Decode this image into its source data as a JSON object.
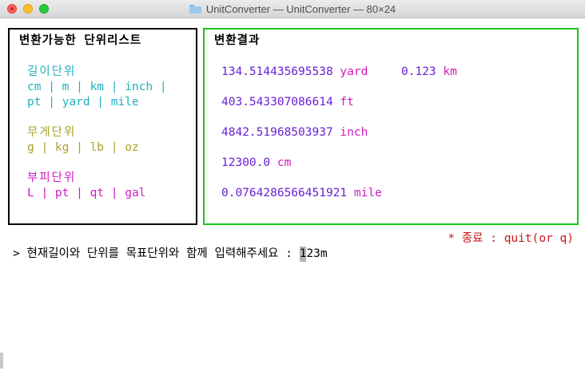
{
  "window": {
    "title": "UnitConverter — UnitConverter — 80×24"
  },
  "left_panel": {
    "heading": "변환가능한 단위리스트",
    "length": {
      "title": "길이단위",
      "line1": "cm | m | km | inch |",
      "line2": "pt | yard | mile"
    },
    "weight": {
      "title": "무게단위",
      "line1": "g | kg | lb | oz"
    },
    "volume": {
      "title": "부피단위",
      "line1": "L | pt | qt | gal"
    }
  },
  "right_panel": {
    "heading": "변환결과",
    "results": [
      {
        "value": "134.514435695538",
        "unit": "yard"
      },
      {
        "value": "0.123",
        "unit": "km"
      },
      {
        "value": "403.543307086614",
        "unit": "ft"
      },
      {
        "value": "4842.51968503937",
        "unit": "inch"
      },
      {
        "value": "12300.0",
        "unit": "cm"
      },
      {
        "value": "0.0764286566451921",
        "unit": "mile"
      }
    ]
  },
  "quit_hint": "* 종료 : quit(or q)",
  "prompt": {
    "text": "> 현재길이와 단위를 목표단위와 함께 입력해주세요 : ",
    "cursor_char": "1",
    "input_rest": "23m"
  },
  "colors": {
    "length": "#1fb1c1",
    "weight": "#a9a22a",
    "volume": "#d01ac1",
    "value": "#6a1fd6",
    "result_border": "#17c51a",
    "quit": "#c7171a"
  }
}
